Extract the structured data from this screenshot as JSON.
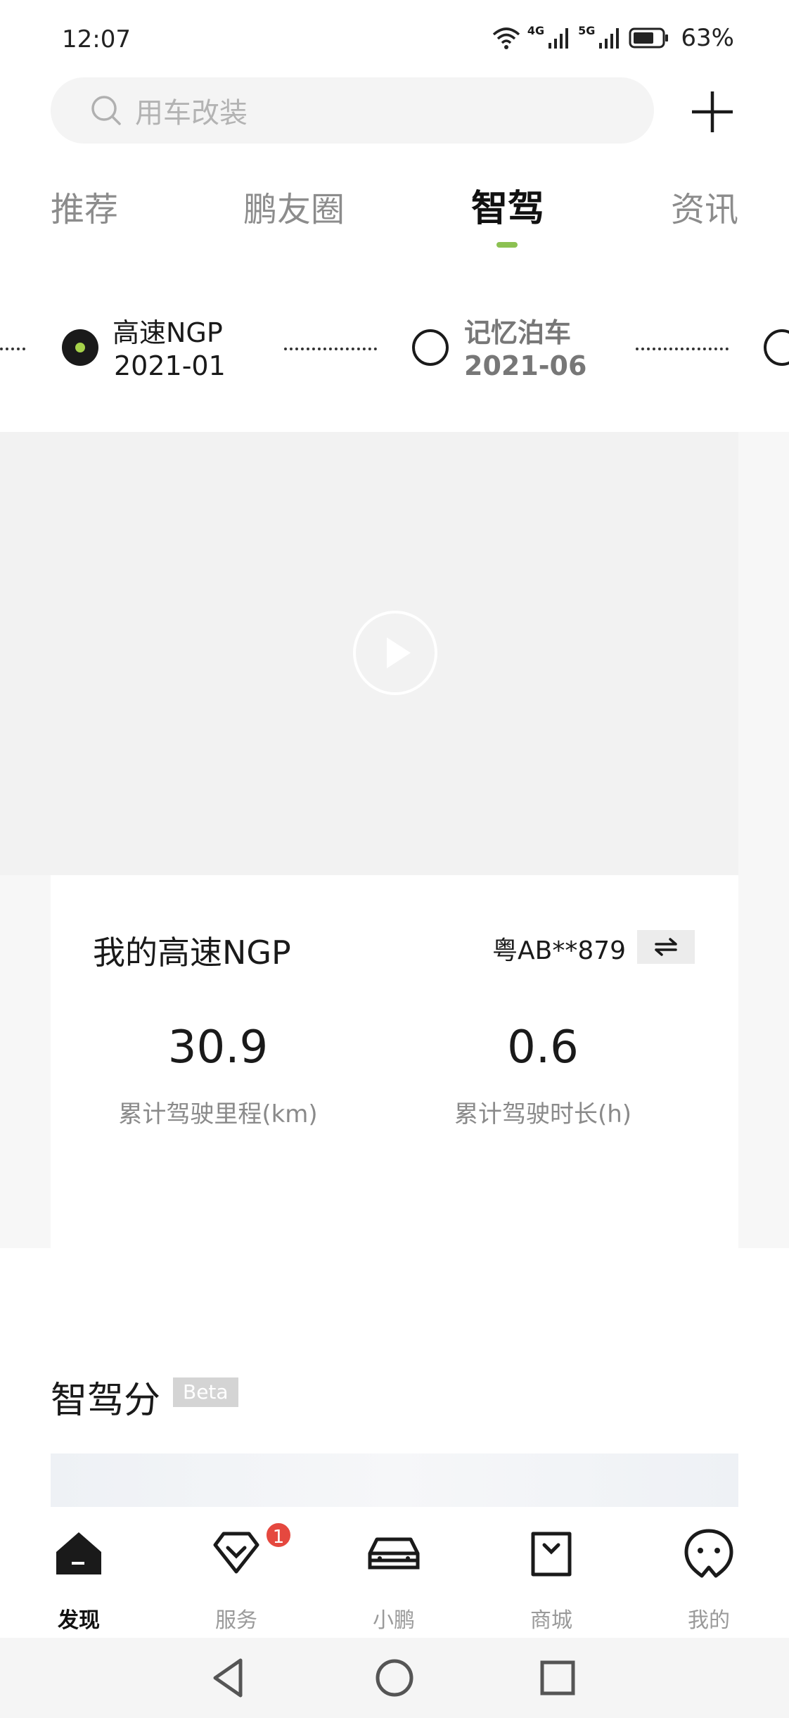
{
  "status_bar": {
    "time": "12:07",
    "network_4g": "4G",
    "network_5g": "5G",
    "battery_percent": "63%"
  },
  "search": {
    "placeholder": "用车改装"
  },
  "tabs": [
    {
      "label": "推荐",
      "active": false
    },
    {
      "label": "鹏友圈",
      "active": false
    },
    {
      "label": "智驾",
      "active": true
    },
    {
      "label": "资讯",
      "active": false
    }
  ],
  "timeline": [
    {
      "title": "高速NGP",
      "date": "2021-01",
      "active": true
    },
    {
      "title": "记忆泊车",
      "date": "2021-06",
      "active": false
    }
  ],
  "ngp_card": {
    "title": "我的高速NGP",
    "plate": "粤AB**879",
    "stats": [
      {
        "value": "30.9",
        "label": "累计驾驶里程(km)"
      },
      {
        "value": "0.6",
        "label": "累计驾驶时长(h)"
      }
    ]
  },
  "score_section": {
    "title": "智驾分",
    "badge": "Beta"
  },
  "bottom_nav": [
    {
      "label": "发现",
      "icon": "home-icon",
      "active": true
    },
    {
      "label": "服务",
      "icon": "service-icon",
      "active": false,
      "badge": "1"
    },
    {
      "label": "小鹏",
      "icon": "car-icon",
      "active": false
    },
    {
      "label": "商城",
      "icon": "shop-bag-icon",
      "active": false
    },
    {
      "label": "我的",
      "icon": "profile-face-icon",
      "active": false
    }
  ],
  "colors": {
    "accent": "#8cc152",
    "badge": "#e5483f",
    "text_primary": "#1a1a1a",
    "text_muted": "#8a8a8a"
  }
}
